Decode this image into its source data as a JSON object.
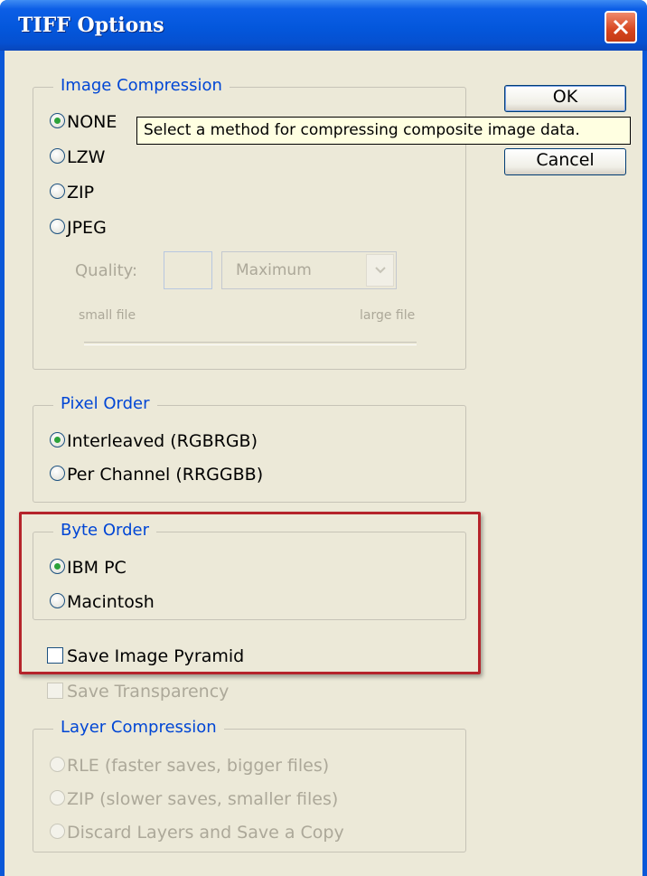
{
  "window": {
    "title": "TIFF Options"
  },
  "buttons": {
    "ok_label": "OK",
    "cancel_label": "Cancel"
  },
  "tooltip": {
    "text": "Select a method for compressing composite image data."
  },
  "image_compression": {
    "title": "Image Compression",
    "options": [
      "NONE",
      "LZW",
      "ZIP",
      "JPEG"
    ],
    "selected": "NONE",
    "quality_label": "Quality:",
    "quality_value": "",
    "quality_preset": "Maximum",
    "small_file_label": "small file",
    "large_file_label": "large file"
  },
  "pixel_order": {
    "title": "Pixel Order",
    "options": [
      "Interleaved (RGBRGB)",
      "Per Channel (RRGGBB)"
    ],
    "selected": "Interleaved (RGBRGB)"
  },
  "byte_order": {
    "title": "Byte Order",
    "options": [
      "IBM PC",
      "Macintosh"
    ],
    "selected": "IBM PC"
  },
  "checkboxes": {
    "save_image_pyramid": {
      "label": "Save Image Pyramid",
      "checked": false
    },
    "save_transparency": {
      "label": "Save Transparency",
      "checked": false
    }
  },
  "layer_compression": {
    "title": "Layer Compression",
    "options": [
      "RLE (faster saves, bigger files)",
      "ZIP (slower saves, smaller files)",
      "Discard Layers and Save a Copy"
    ]
  },
  "colors": {
    "titlebar": "#0457dc",
    "dialog_bg": "#ece9d8",
    "group_title": "#0046d5",
    "highlight_border": "#b5242b",
    "tooltip_bg": "#ffffe1",
    "radio_selected": "#2ca23a"
  }
}
